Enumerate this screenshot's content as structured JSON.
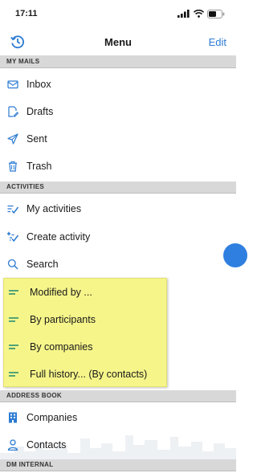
{
  "status_bar": {
    "time": "17:11"
  },
  "nav": {
    "title": "Menu",
    "edit_label": "Edit"
  },
  "sections": {
    "my_mails": "MY MAILS",
    "activities": "ACTIVITIES",
    "address_book": "ADDRESS BOOK",
    "dm_internal": "DM INTERNAL"
  },
  "mail_items": [
    {
      "label": "Inbox",
      "icon": "inbox-icon"
    },
    {
      "label": "Drafts",
      "icon": "drafts-icon"
    },
    {
      "label": "Sent",
      "icon": "sent-icon"
    },
    {
      "label": "Trash",
      "icon": "trash-icon"
    }
  ],
  "activity_items": [
    {
      "label": "My activities",
      "icon": "activities-checklist-icon"
    },
    {
      "label": "Create activity",
      "icon": "create-activity-icon"
    },
    {
      "label": "Search",
      "icon": "search-icon"
    }
  ],
  "filter_items": [
    {
      "label": "Modified by ...",
      "icon": "list-icon"
    },
    {
      "label": "By participants",
      "icon": "list-icon"
    },
    {
      "label": "By companies",
      "icon": "list-icon"
    },
    {
      "label": "Full history... (By contacts)",
      "icon": "list-icon"
    }
  ],
  "address_items": [
    {
      "label": "Companies",
      "icon": "building-icon"
    },
    {
      "label": "Contacts",
      "icon": "person-icon"
    }
  ],
  "colors": {
    "accent": "#2b7bd3",
    "highlight": "#f6f58a",
    "list_icon": "#1f8a70",
    "section_bg": "#d8d8d8"
  }
}
